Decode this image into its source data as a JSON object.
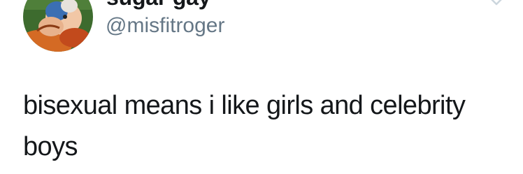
{
  "author": {
    "display_name": "sugar gay",
    "handle": "@misfitroger",
    "avatar_icon": "cartoon-avatar"
  },
  "menu": {
    "icon": "chevron-down-icon"
  },
  "tweet": {
    "text": "bisexual means i like girls and celebrity boys"
  },
  "colors": {
    "text": "#14171a",
    "secondary_text": "#657786",
    "chevron": "#ccd6dd",
    "background": "#ffffff"
  }
}
